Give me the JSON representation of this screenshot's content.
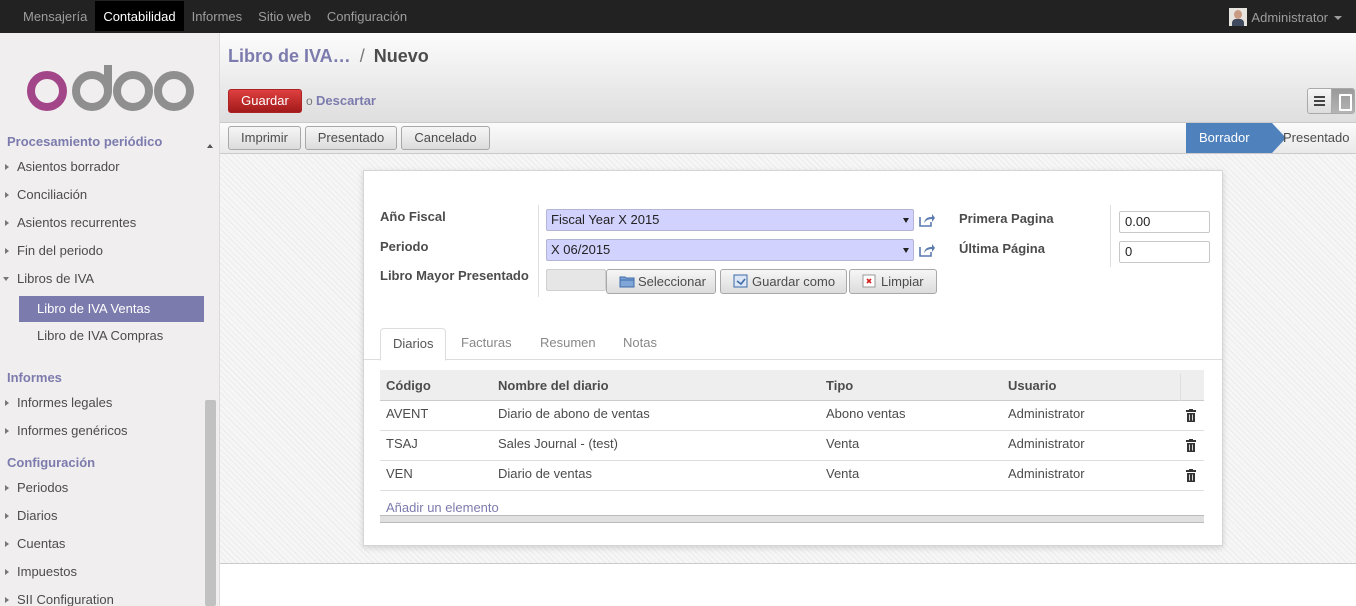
{
  "topbar": {
    "menu": [
      "Mensajería",
      "Contabilidad",
      "Informes",
      "Sitio web",
      "Configuración"
    ],
    "active_index": 1,
    "user": "Administrator"
  },
  "sidebar": {
    "logo_text": "odoo",
    "section_top": "Procesamiento periódico",
    "items_top": [
      {
        "label": "Asientos borrador"
      },
      {
        "label": "Conciliación"
      },
      {
        "label": "Asientos recurrentes"
      },
      {
        "label": "Fin del periodo"
      },
      {
        "label": "Libros de IVA"
      }
    ],
    "subitems": [
      {
        "label": "Libro de IVA Ventas",
        "active": true
      },
      {
        "label": "Libro de IVA Compras",
        "active": false
      }
    ],
    "section_informes": "Informes",
    "items_informes": [
      {
        "label": "Informes legales"
      },
      {
        "label": "Informes genéricos"
      }
    ],
    "section_config": "Configuración",
    "items_config": [
      {
        "label": "Periodos"
      },
      {
        "label": "Diarios"
      },
      {
        "label": "Cuentas"
      },
      {
        "label": "Impuestos"
      },
      {
        "label": "SII Configuration"
      }
    ]
  },
  "header": {
    "breadcrumb_parent": "Libro de IVA…",
    "breadcrumb_sep": "/",
    "breadcrumb_current": "Nuevo",
    "save_label": "Guardar",
    "or_text": "o",
    "discard_label": "Descartar"
  },
  "statusbar": {
    "buttons": [
      "Imprimir",
      "Presentado",
      "Cancelado"
    ],
    "states": [
      "Borrador",
      "Presentado"
    ],
    "current_state": "Borrador"
  },
  "form": {
    "fiscal_year_label": "Año Fiscal",
    "fiscal_year_value": "Fiscal Year X 2015",
    "period_label": "Periodo",
    "period_value": "X 06/2015",
    "ledger_label": "Libro Mayor Presentado",
    "select_label": "Seleccionar",
    "save_as_label": "Guardar como",
    "clear_label": "Limpiar",
    "first_page_label": "Primera Pagina",
    "first_page_value": "0.00",
    "last_page_label": "Última Página",
    "last_page_value": "0"
  },
  "tabs": [
    "Diarios",
    "Facturas",
    "Resumen",
    "Notas"
  ],
  "active_tab": 0,
  "journals": {
    "columns": [
      "Código",
      "Nombre del diario",
      "Tipo",
      "Usuario"
    ],
    "rows": [
      [
        "AVENT",
        "Diario de abono de ventas",
        "Abono ventas",
        "Administrator"
      ],
      [
        "TSAJ",
        "Sales Journal - (test)",
        "Venta",
        "Administrator"
      ],
      [
        "VEN",
        "Diario de ventas",
        "Venta",
        "Administrator"
      ]
    ],
    "add_line": "Añadir un elemento"
  },
  "colors": {
    "accent": "#7c7bad",
    "save_button": "#c02c2c",
    "state_active": "#4f81bd",
    "selection_bg": "#d2d2ff"
  }
}
